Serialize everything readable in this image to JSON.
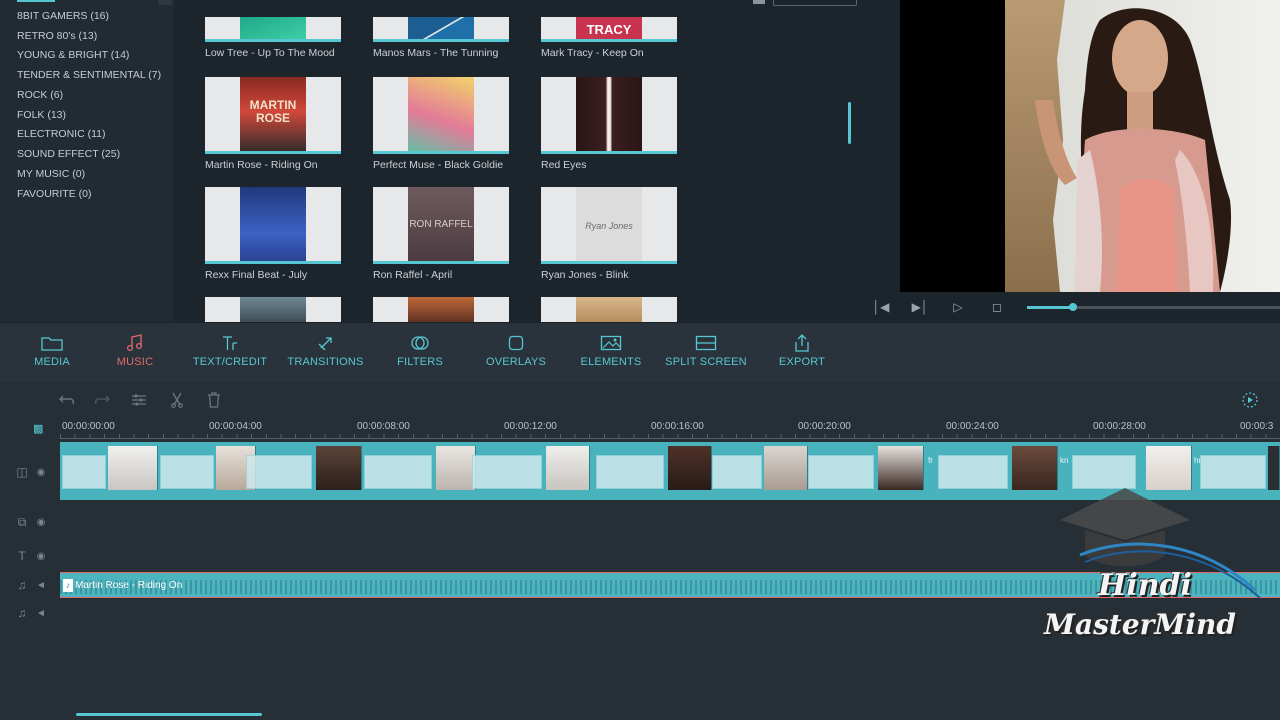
{
  "categories": [
    "8BIT GAMERS (16)",
    "RETRO 80's (13)",
    "YOUNG & BRIGHT (14)",
    "TENDER & SENTIMENTAL (7)",
    "ROCK (6)",
    "FOLK (13)",
    "ELECTRONIC (11)",
    "SOUND EFFECT (25)",
    "MY MUSIC (0)",
    "FAVOURITE (0)"
  ],
  "library": {
    "tiles": [
      {
        "title": "Low Tree - Up To The Mood",
        "color": "#2fbf9a"
      },
      {
        "title": "Manos Mars - The Tunning",
        "color": "#1f6fa8"
      },
      {
        "title": "Mark Tracy - Keep On",
        "color": "#c8334d",
        "art_text": "TRACY"
      },
      {
        "title": "Martin Rose - Riding On",
        "color": "#b4322a",
        "art_text": "MARTIN ROSE"
      },
      {
        "title": "Perfect Muse - Black Goldie",
        "color": "#e37b97"
      },
      {
        "title": "Red Eyes",
        "color": "#3a1e20"
      },
      {
        "title": "Rexx Final Beat - July",
        "color": "#2f4fa6"
      },
      {
        "title": "Ron Raffel - April",
        "color": "#5a4a50",
        "art_text": "RON RAFFEL"
      },
      {
        "title": "Ryan Jones - Blink",
        "color": "#dcdcdc",
        "art_text": "Ryan Jones"
      }
    ]
  },
  "preview": {
    "progress": 0.18
  },
  "tabs": [
    {
      "label": "MEDIA",
      "icon": "folder-icon"
    },
    {
      "label": "MUSIC",
      "icon": "music-note-icon",
      "active": true
    },
    {
      "label": "TEXT/CREDIT",
      "icon": "text-icon"
    },
    {
      "label": "TRANSITIONS",
      "icon": "transitions-icon"
    },
    {
      "label": "FILTERS",
      "icon": "filters-icon"
    },
    {
      "label": "OVERLAYS",
      "icon": "overlays-icon"
    },
    {
      "label": "ELEMENTS",
      "icon": "elements-icon"
    },
    {
      "label": "SPLIT SCREEN",
      "icon": "split-screen-icon"
    },
    {
      "label": "EXPORT",
      "icon": "export-icon"
    }
  ],
  "timeline": {
    "ticks": [
      "00:00:00:00",
      "00:00:04:00",
      "00:00:08:00",
      "00:00:12:00",
      "00:00:16:00",
      "00:00:20:00",
      "00:00:24:00",
      "00:00:28:00",
      "00:00:3"
    ],
    "clip_labels": [
      "fr",
      "ho",
      "kn",
      "hr"
    ],
    "audio_clip": "Martin Rose - Riding On"
  },
  "watermark": {
    "line1": "Hindi",
    "line2": "MasterMind"
  }
}
